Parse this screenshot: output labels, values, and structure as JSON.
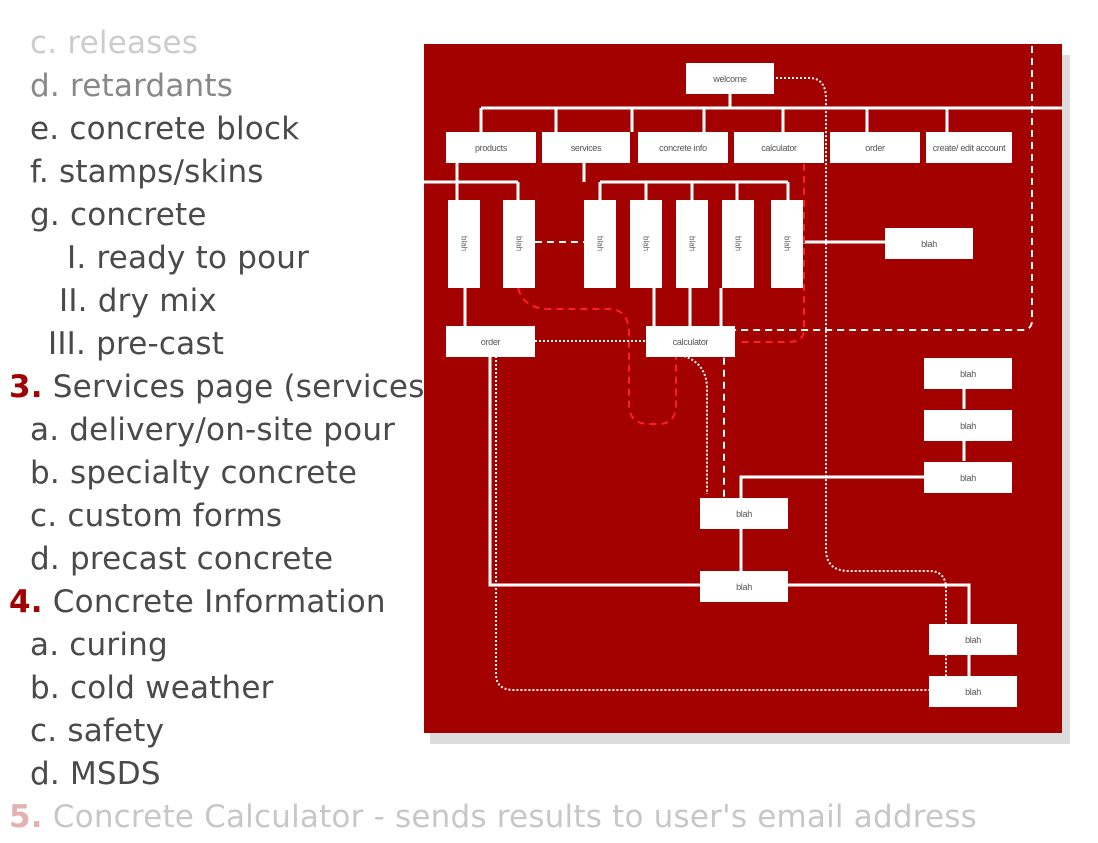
{
  "outline": {
    "lines": [
      {
        "text": "c. releases"
      },
      {
        "text": "d. retardants"
      },
      {
        "text": "e. concrete block"
      },
      {
        "text": "f.  stamps/skins"
      },
      {
        "text": "g. concrete"
      },
      {
        "text": "I. ready to pour"
      },
      {
        "text": "II. dry mix"
      },
      {
        "text": "III. pre-cast"
      },
      {
        "num": "3.",
        "text": " Services page (services"
      },
      {
        "text": "a. delivery/on-site pour"
      },
      {
        "text": "b. specialty concrete"
      },
      {
        "text": "c. custom forms"
      },
      {
        "text": "d. precast concrete"
      },
      {
        "num": "4.",
        "text": " Concrete Information"
      },
      {
        "text": "a. curing"
      },
      {
        "text": "b. cold weather"
      },
      {
        "text": "c. safety"
      },
      {
        "text": "d. MSDS"
      },
      {
        "num": "5.",
        "text": " Concrete Calculator - sends results to user's email address"
      }
    ]
  },
  "sitemap": {
    "background_color": "#a30000",
    "root": "welcome",
    "top_nav": [
      "products",
      "services",
      "concrete info",
      "calculator",
      "order",
      "create/ edit account"
    ],
    "sub_pages": [
      "blah",
      "blah",
      "blah",
      "blah",
      "blah",
      "blah",
      "blah"
    ],
    "order": "order",
    "calculator": "calculator",
    "side_node": "blah",
    "account_chain": [
      "blah",
      "blah",
      "blah"
    ],
    "flow_nodes": [
      "blah",
      "blah",
      "blah",
      "blah"
    ]
  }
}
